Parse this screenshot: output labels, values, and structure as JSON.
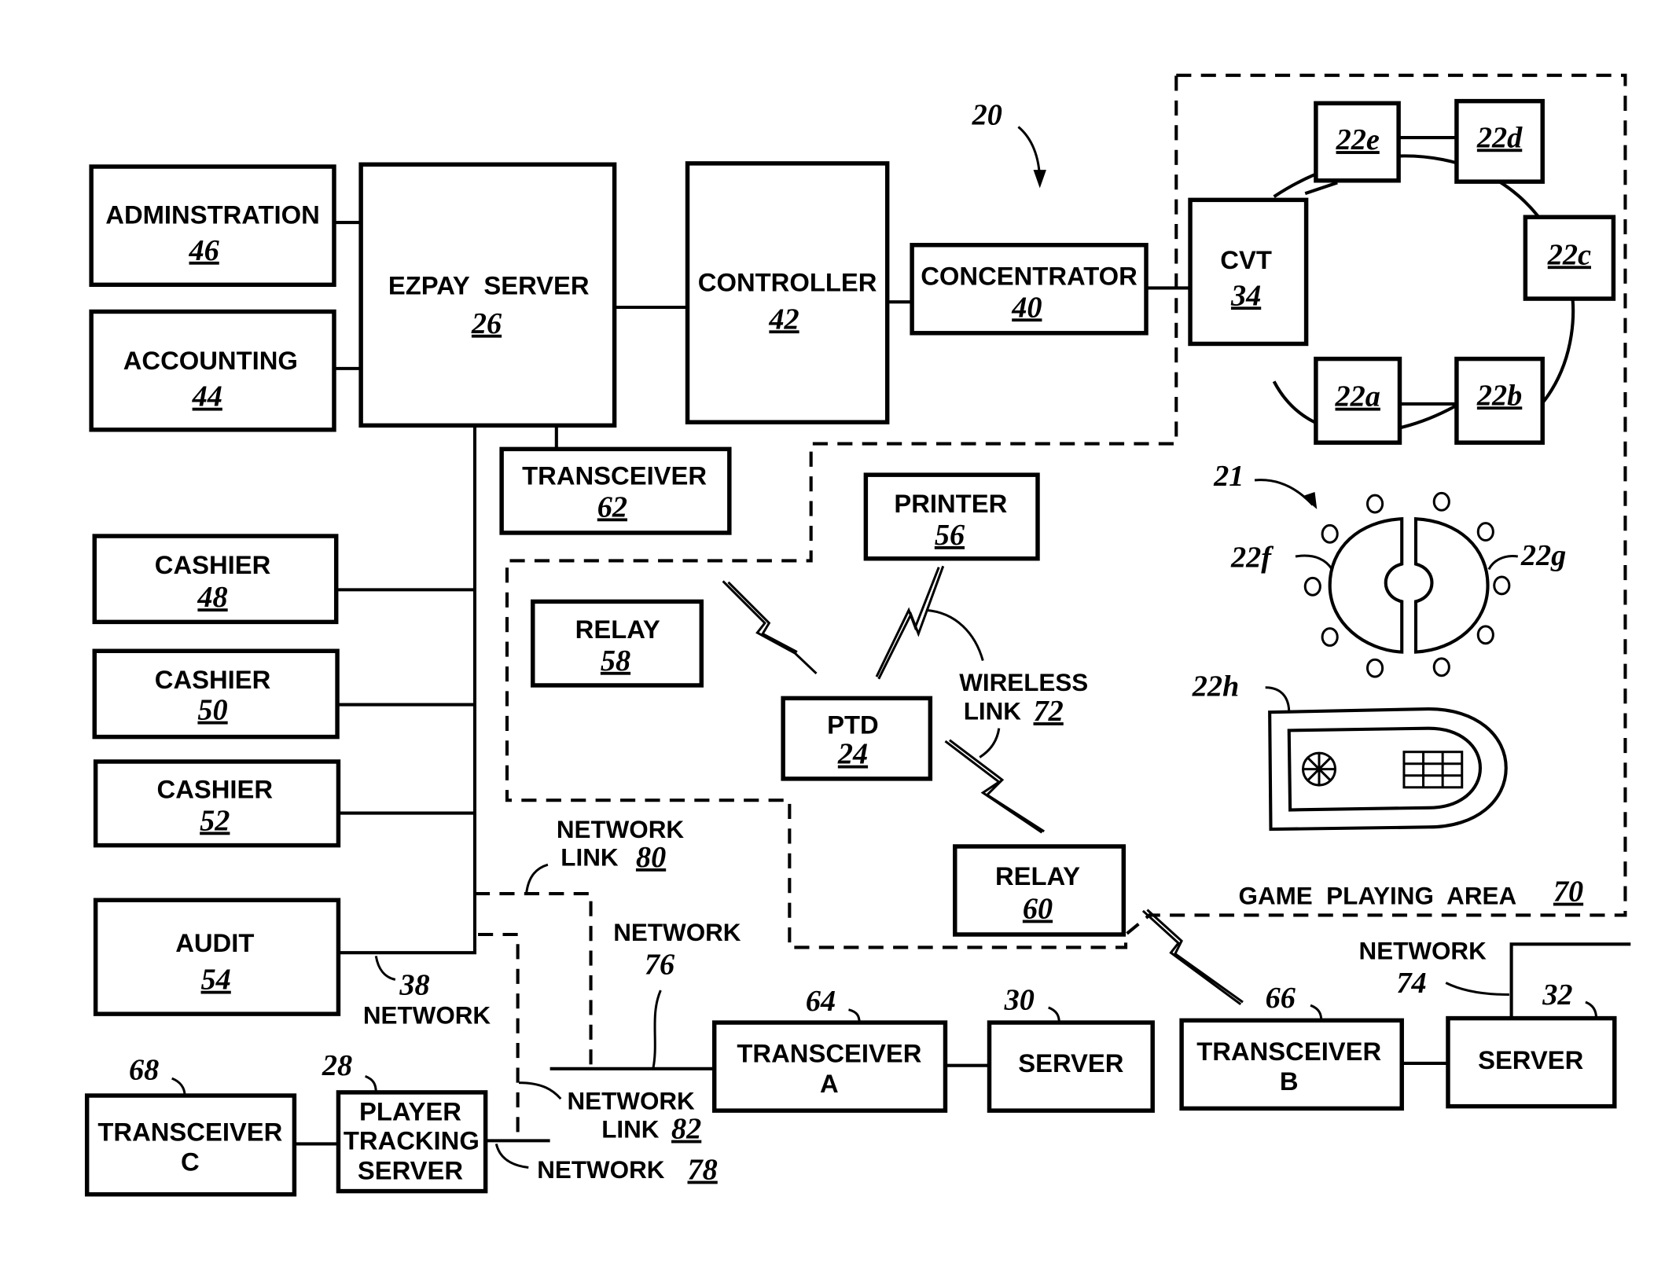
{
  "figure": {
    "system_ref": "20",
    "table_ref": "21"
  },
  "blocks": {
    "administration": {
      "label": "ADMINSTRATION",
      "ref": "46"
    },
    "accounting": {
      "label": "ACCOUNTING",
      "ref": "44"
    },
    "ezpay_server": {
      "label": "EZPAY  SERVER",
      "ref": "26"
    },
    "controller": {
      "label": "CONTROLLER",
      "ref": "42"
    },
    "concentrator": {
      "label": "CONCENTRATOR",
      "ref": "40"
    },
    "cvt": {
      "label": "CVT",
      "ref": "34"
    },
    "transceiver_62": {
      "label": "TRANSCEIVER",
      "ref": "62"
    },
    "printer": {
      "label": "PRINTER",
      "ref": "56"
    },
    "relay_58": {
      "label": "RELAY",
      "ref": "58"
    },
    "relay_60": {
      "label": "RELAY",
      "ref": "60"
    },
    "ptd": {
      "label": "PTD",
      "ref": "24"
    },
    "cashier_48": {
      "label": "CASHIER",
      "ref": "48"
    },
    "cashier_50": {
      "label": "CASHIER",
      "ref": "50"
    },
    "cashier_52": {
      "label": "CASHIER",
      "ref": "52"
    },
    "audit": {
      "label": "AUDIT",
      "ref": "54"
    },
    "transceiver_c": {
      "line1": "TRANSCEIVER",
      "line2": "C",
      "ref": "68"
    },
    "player_tracking": {
      "line1": "PLAYER",
      "line2": "TRACKING",
      "line3": "SERVER",
      "ref": "28"
    },
    "transceiver_a": {
      "line1": "TRANSCEIVER",
      "line2": "A",
      "ref": "64"
    },
    "server_30": {
      "label": "SERVER",
      "ref": "30"
    },
    "transceiver_b": {
      "line1": "TRANSCEIVER",
      "line2": "B",
      "ref": "66"
    },
    "server_32": {
      "label": "SERVER",
      "ref": "32"
    }
  },
  "gaming_machines": {
    "m22e": "22e",
    "m22d": "22d",
    "m22c": "22c",
    "m22a": "22a",
    "m22b": "22b",
    "m22f": "22f",
    "m22g": "22g",
    "m22h": "22h"
  },
  "annotations": {
    "wireless_link": {
      "line1": "WIRELESS",
      "line2": "LINK",
      "ref": "72"
    },
    "game_area": {
      "label": "GAME  PLAYING  AREA",
      "ref": "70"
    },
    "network_link_80": {
      "line1": "NETWORK",
      "line2": "LINK",
      "ref": "80"
    },
    "network_76": {
      "line1": "NETWORK",
      "ref": "76"
    },
    "network_38": {
      "ref": "38",
      "line1": "NETWORK"
    },
    "network_link_82": {
      "line1": "NETWORK",
      "line2": "LINK",
      "ref": "82"
    },
    "network_78": {
      "line1": "NETWORK",
      "ref": "78"
    },
    "network_74": {
      "line1": "NETWORK",
      "ref": "74"
    }
  }
}
